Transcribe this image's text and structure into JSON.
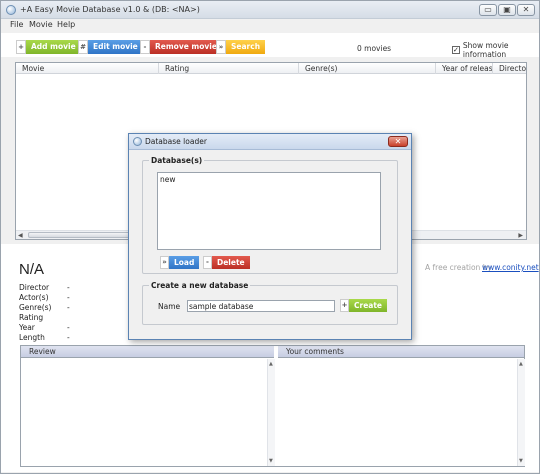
{
  "window": {
    "title": "+A Easy Movie Database v1.0 & (DB: <NA>)",
    "controls": {
      "minimize": "▭",
      "maximize": "▣",
      "close": "✕"
    }
  },
  "menu": [
    "File",
    "Movie",
    "Help"
  ],
  "toolbar": {
    "add_icon": "+",
    "add_label": "Add movie",
    "edit_icon": "#",
    "edit_label": "Edit movie",
    "remove_icon": "-",
    "remove_label": "Remove movie",
    "search_icon": "»",
    "search_label": "Search",
    "movie_count": "0 movies",
    "show_info_label": "Show movie information",
    "show_info_checked": "✓"
  },
  "movie_list": {
    "columns": [
      "Movie",
      "Rating",
      "Genre(s)",
      "Year of release",
      "Director"
    ],
    "scroll_left": "◀",
    "scroll_right": "▶"
  },
  "details": {
    "title": "N/A",
    "fields": [
      {
        "label": "Director",
        "value": "-"
      },
      {
        "label": "Actor(s)",
        "value": "-"
      },
      {
        "label": "Genre(s)",
        "value": "-"
      },
      {
        "label": "Rating",
        "value": ""
      },
      {
        "label": "Year",
        "value": "-"
      },
      {
        "label": "Length",
        "value": "-"
      }
    ],
    "credit_text": "A free creation by",
    "credit_link": "www.conity.net",
    "review_header": "Review",
    "comments_header": "Your comments",
    "scroll_up": "▲",
    "scroll_down": "▼"
  },
  "dialog": {
    "title": "Database loader",
    "close": "✕",
    "databases_legend": "Database(s)",
    "databases": [
      "new"
    ],
    "load_icon": "»",
    "load_label": "Load",
    "delete_icon": "-",
    "delete_label": "Delete",
    "create_legend": "Create a new database",
    "name_label": "Name",
    "name_value": "sample database",
    "create_icon": "+",
    "create_label": "Create"
  }
}
